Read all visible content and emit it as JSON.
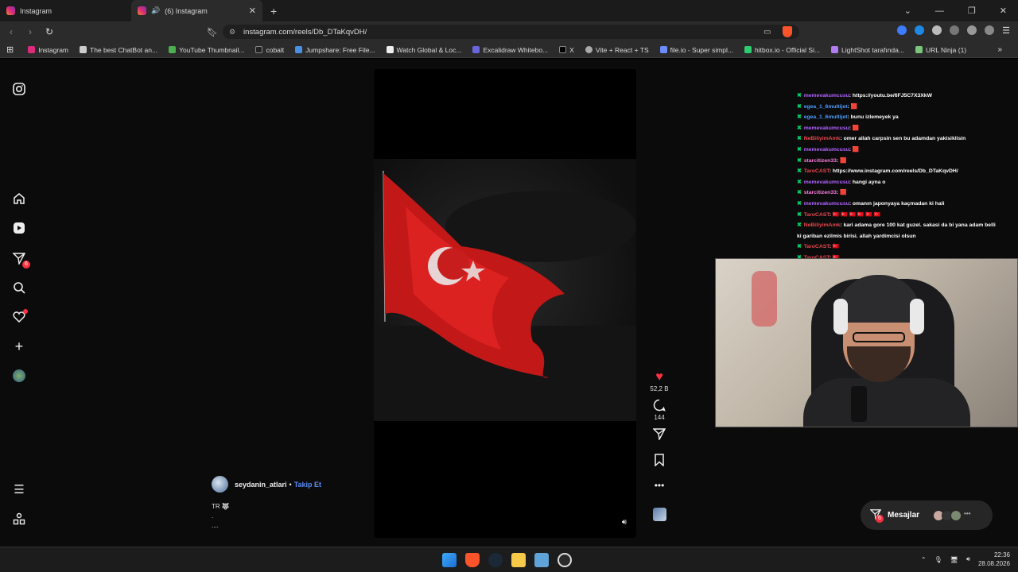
{
  "browser": {
    "tabs": [
      {
        "label": "Instagram"
      },
      {
        "label": "(6) Instagram"
      }
    ],
    "url": "instagram.com/reels/Db_DTaKqvDH/",
    "bookmarks": [
      "Instagram",
      "The best ChatBot an...",
      "YouTube Thumbnail...",
      "cobalt",
      "Jumpshare: Free File...",
      "Watch Global & Loc...",
      "Excalidraw Whitebo...",
      "X",
      "Vite + React + TS",
      "file.io - Super simpl...",
      "hitbox.io - Official Si...",
      "LightShot tarafında...",
      "URL Ninja (1)"
    ]
  },
  "sidebar": {
    "notifications_badge": "6"
  },
  "reel": {
    "likes": "52,2 B",
    "comments": "144",
    "username": "seydanin_atlari",
    "separator": "•",
    "follow_label": "Takip Et",
    "caption_line1": "TR 🐺",
    "caption_line2": ".",
    "caption_line3": "...."
  },
  "chat": [
    {
      "user": "memevakumcusu",
      "color": "purple",
      "text": ": https://youtu.be/6FJ5C7X3XkW"
    },
    {
      "user": "egea_1_6multijet",
      "color": "blue",
      "text": ": 🟥"
    },
    {
      "user": "egea_1_6multijet",
      "color": "blue",
      "text": ": bunu izlemeyek ya"
    },
    {
      "user": "memevakumcusu",
      "color": "purple",
      "text": ": 🟥"
    },
    {
      "user": "NeBiliyimAmk",
      "color": "red",
      "text": ": omer allah carpsin sen bu adamdan yakisiklisin"
    },
    {
      "user": "memevakumcusu",
      "color": "purple",
      "text": ": 🟥"
    },
    {
      "user": "starcitizen33",
      "color": "pink",
      "text": ": 🟥"
    },
    {
      "user": "TaroCAST",
      "color": "red",
      "text": ": https://www.instagram.com/reels/Db_DTaKqvDH/"
    },
    {
      "user": "memevakumcusu",
      "color": "purple",
      "text": ": hangi ayna o"
    },
    {
      "user": "starcitizen33",
      "color": "pink",
      "text": ": 🟥"
    },
    {
      "user": "memevakumcusu",
      "color": "purple",
      "text": ": omanın japonyaya kaçmadan ki hali"
    },
    {
      "user": "TaroCAST",
      "color": "red",
      "text": ": 🇹🇷 🇹🇷 🇹🇷 🇹🇷 🇹🇷 🇹🇷"
    },
    {
      "user": "NeBiliyimAmk",
      "color": "red",
      "text": ": kari adama gore 100 kat guzel. sakasi da bi yana adam belli"
    },
    {
      "user": "",
      "color": "blue",
      "text": "ki gariban ezilmis birisi. allah yardimcisi olsun"
    },
    {
      "user": "TaroCAST",
      "color": "red",
      "text": ": 🇹🇷"
    },
    {
      "user": "TaroCAST",
      "color": "red",
      "text": ": 🇹🇷"
    }
  ],
  "messages": {
    "label": "Mesajlar",
    "badge": "6"
  },
  "taskbar": {
    "time": "22:36",
    "date": "28.08.2026"
  },
  "colors": {
    "follow": "#5b8cf5",
    "notification": "#ff3040",
    "flag_red": "#d81e1e"
  }
}
